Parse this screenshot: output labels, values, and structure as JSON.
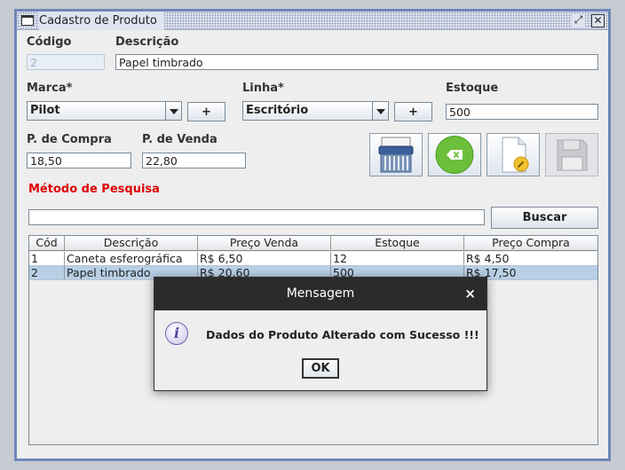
{
  "window": {
    "title": "Cadastro de Produto",
    "maximize_glyph": "⤢",
    "close_glyph": "✕"
  },
  "form": {
    "codigo": {
      "label": "Código",
      "value": "2"
    },
    "descricao": {
      "label": "Descrição",
      "value": "Papel timbrado"
    },
    "marca": {
      "label": "Marca*",
      "value": "Pilot",
      "add_label": "+"
    },
    "linha": {
      "label": "Linha*",
      "value": "Escritório",
      "add_label": "+"
    },
    "estoque": {
      "label": "Estoque",
      "value": "500"
    },
    "p_compra": {
      "label": "P. de Compra",
      "value": "18,50"
    },
    "p_venda": {
      "label": "P. de Venda",
      "value": "22,80"
    }
  },
  "toolbar": {
    "icons": [
      "shredder-icon",
      "clear-icon",
      "edit-document-icon",
      "save-icon"
    ]
  },
  "search": {
    "label": "Método de Pesquisa",
    "value": "",
    "button_label": "Buscar"
  },
  "table": {
    "columns": [
      "Cód",
      "Descrição",
      "Preço Venda",
      "Estoque",
      "Preço Compra"
    ],
    "rows": [
      [
        "1",
        "Caneta esferográfica",
        "R$  6,50",
        "12",
        "R$  4,50"
      ],
      [
        "2",
        "Papel timbrado",
        "R$  20,60",
        "500",
        "R$  17,50"
      ]
    ],
    "selected_row": 1
  },
  "dialog": {
    "title": "Mensagem",
    "close_glyph": "×",
    "icon_glyph": "i",
    "message": "Dados do Produto Alterado com Sucesso !!!",
    "ok_label": "OK"
  },
  "colors": {
    "title_bar": "#dfe4f0",
    "window_border": "#6f86b8",
    "accent_red": "#dd0000",
    "selected_row": "#b8cfe5",
    "dialog_title": "#2b2b2b"
  }
}
